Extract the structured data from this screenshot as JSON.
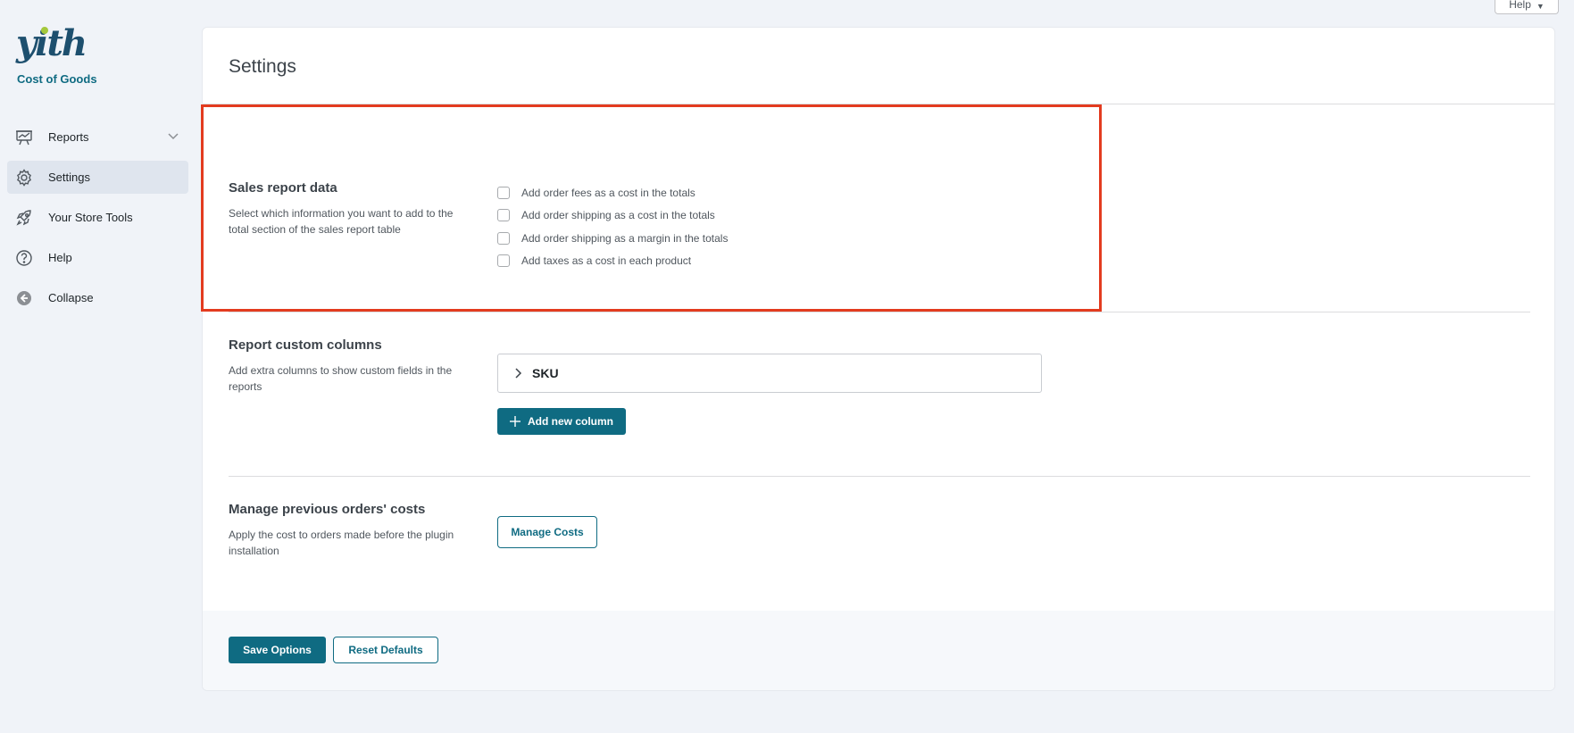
{
  "sidebar": {
    "logo": "yith",
    "plugin_name": "Cost of Goods",
    "items": [
      {
        "label": "Reports",
        "icon": "chart-easel-icon"
      },
      {
        "label": "Settings",
        "icon": "gear-icon"
      },
      {
        "label": "Your Store Tools",
        "icon": "rocket-icon"
      },
      {
        "label": "Help",
        "icon": "question-circle-icon"
      },
      {
        "label": "Collapse",
        "icon": "arrow-left-circle-icon"
      }
    ]
  },
  "help_tab": {
    "label": "Help"
  },
  "page": {
    "title": "Settings"
  },
  "sales_report": {
    "title": "Sales report data",
    "description": "Select which information you want to add to the total section of the sales report table",
    "options": [
      "Add order fees as a cost in the totals",
      "Add order shipping as a cost in the totals",
      "Add order shipping as a margin in the totals",
      "Add taxes as a cost in each product"
    ]
  },
  "custom_columns": {
    "title": "Report custom columns",
    "description": "Add extra columns to show custom fields in the reports",
    "columns": [
      "SKU"
    ],
    "add_label": "Add new column"
  },
  "previous_orders": {
    "title": "Manage previous orders' costs",
    "description": "Apply the cost to orders made before the plugin installation",
    "button_label": "Manage Costs"
  },
  "footer": {
    "save_label": "Save Options",
    "reset_label": "Reset Defaults"
  },
  "colors": {
    "accent": "#0f6b82",
    "highlight": "#e33b1f",
    "background": "#f0f3f8"
  }
}
